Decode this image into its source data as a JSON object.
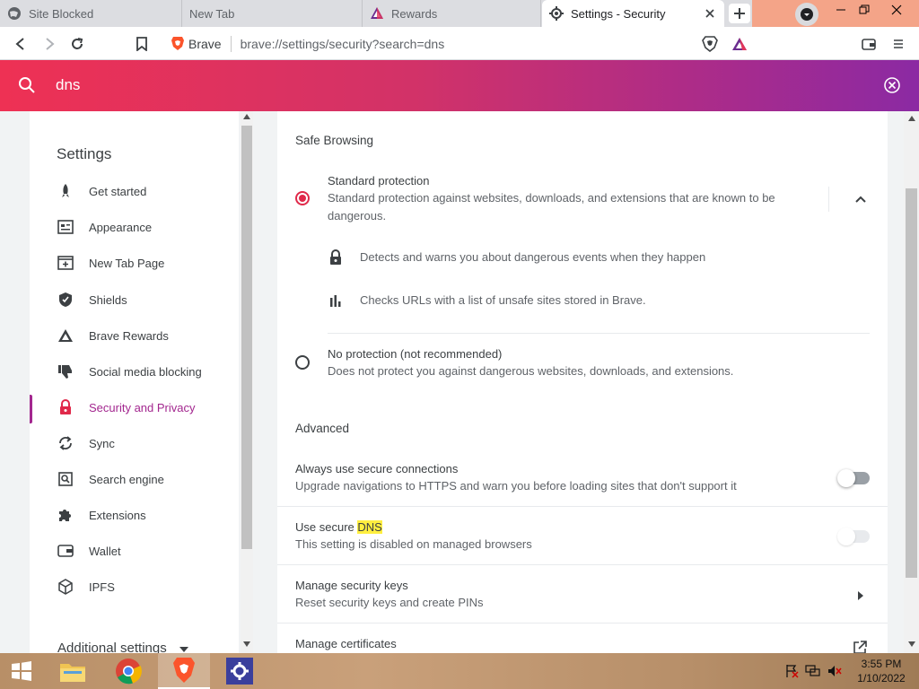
{
  "tabs": [
    {
      "title": "Site Blocked",
      "icon": "globe-icon"
    },
    {
      "title": "New Tab",
      "icon": ""
    },
    {
      "title": "Rewards",
      "icon": "brave-rewards-icon"
    },
    {
      "title": "Settings - Security",
      "icon": "gear-icon",
      "active": true
    }
  ],
  "toolbar": {
    "brand": "Brave",
    "url": "brave://settings/security?search=dns"
  },
  "search": {
    "query": "dns"
  },
  "sidebar": {
    "title": "Settings",
    "items": [
      {
        "label": "Get started",
        "icon": "rocket-icon"
      },
      {
        "label": "Appearance",
        "icon": "appearance-icon"
      },
      {
        "label": "New Tab Page",
        "icon": "new-tab-page-icon"
      },
      {
        "label": "Shields",
        "icon": "shield-icon"
      },
      {
        "label": "Brave Rewards",
        "icon": "rewards-triangle-icon"
      },
      {
        "label": "Social media blocking",
        "icon": "thumbs-down-icon"
      },
      {
        "label": "Security and Privacy",
        "icon": "lock-icon",
        "active": true
      },
      {
        "label": "Sync",
        "icon": "sync-icon"
      },
      {
        "label": "Search engine",
        "icon": "search-engine-icon"
      },
      {
        "label": "Extensions",
        "icon": "puzzle-icon"
      },
      {
        "label": "Wallet",
        "icon": "wallet-icon"
      },
      {
        "label": "IPFS",
        "icon": "cube-icon"
      }
    ],
    "more": "Additional settings"
  },
  "main": {
    "safe_browsing_title": "Safe Browsing",
    "standard": {
      "title": "Standard protection",
      "desc": "Standard protection against websites, downloads, and extensions that are known to be dangerous.",
      "selected": true,
      "bullet1": "Detects and warns you about dangerous events when they happen",
      "bullet2": "Checks URLs with a list of unsafe sites stored in Brave."
    },
    "none": {
      "title": "No protection (not recommended)",
      "desc": "Does not protect you against dangerous websites, downloads, and extensions."
    },
    "advanced_title": "Advanced",
    "https": {
      "title": "Always use secure connections",
      "desc": "Upgrade navigations to HTTPS and warn you before loading sites that don't support it",
      "enabled": false
    },
    "dns": {
      "title_prefix": "Use secure ",
      "title_highlight": "DNS",
      "desc": "This setting is disabled on managed browsers",
      "enabled": false,
      "disabled": true
    },
    "keys": {
      "title": "Manage security keys",
      "desc": "Reset security keys and create PINs"
    },
    "certs": {
      "title": "Manage certificates"
    }
  },
  "taskbar": {
    "time": "3:55 PM",
    "date": "1/10/2022"
  },
  "colors": {
    "accent": "#a3278f",
    "radio_selected": "#e0294a",
    "search_gradient_start": "#ee3154",
    "search_gradient_end": "#8b2aa3",
    "highlight": "#ffef40"
  }
}
